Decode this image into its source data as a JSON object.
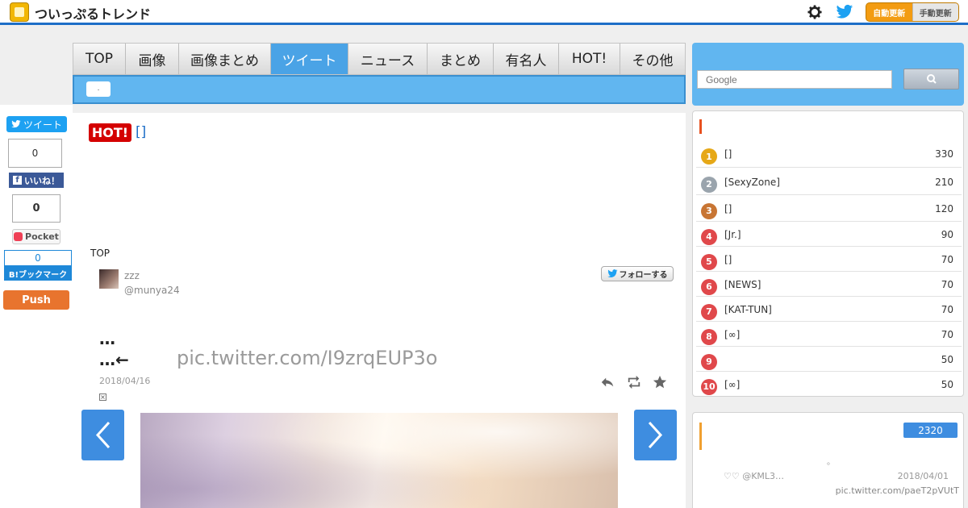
{
  "header": {
    "site_title": "ついっぷるトレンド",
    "auto_update_label": "自動更新",
    "manual_update_label": "手動更新"
  },
  "nav": {
    "tabs": [
      {
        "label": "TOP"
      },
      {
        "label": "画像"
      },
      {
        "label": "画像まとめ"
      },
      {
        "label": "ツイート"
      },
      {
        "label": "ニュース"
      },
      {
        "label": "まとめ"
      },
      {
        "label": "有名人"
      },
      {
        "label": "HOT!"
      },
      {
        "label": "その他"
      }
    ],
    "active_tab": "ツイート",
    "sub_label": "."
  },
  "share": {
    "tweet_label": "ツイート",
    "tweet_count": "0",
    "like_label": "いいね！",
    "like_count": "0",
    "pocket_label": "Pocket",
    "hatena_count": "0",
    "hatena_label": "B!ブックマーク",
    "push_label": "Push"
  },
  "article": {
    "hot_badge": "HOT!",
    "title": "[]",
    "breadcrumb": "TOP",
    "user_name": "zzz",
    "user_handle": "@munya24",
    "follow_label": "フォローする",
    "text_line1": "…",
    "text_line2": "…←",
    "pic_link": "pic.twitter.com/I9zrqEUP3o",
    "date": "2018/04/16",
    "close_mark": "×"
  },
  "search": {
    "placeholder": "Google"
  },
  "ranking": {
    "items": [
      {
        "rank": "1",
        "name": "[]",
        "count": "330",
        "color": "#e6a817"
      },
      {
        "rank": "2",
        "name": "[SexyZone]",
        "count": "210",
        "color": "#9aa4ad"
      },
      {
        "rank": "3",
        "name": "[]",
        "count": "120",
        "color": "#c87533"
      },
      {
        "rank": "4",
        "name": "[Jr.]",
        "count": "90",
        "color": "#e0484b"
      },
      {
        "rank": "5",
        "name": "[]",
        "count": "70",
        "color": "#e0484b"
      },
      {
        "rank": "6",
        "name": "[NEWS]",
        "count": "70",
        "color": "#e0484b"
      },
      {
        "rank": "7",
        "name": "[KAT-TUN]",
        "count": "70",
        "color": "#e0484b"
      },
      {
        "rank": "8",
        "name": "[∞]",
        "count": "70",
        "color": "#e0484b"
      },
      {
        "rank": "9",
        "name": "",
        "count": "50",
        "color": "#e0484b"
      },
      {
        "rank": "10",
        "name": "[∞]",
        "count": "50",
        "color": "#e0484b"
      }
    ]
  },
  "panel2": {
    "badge": "2320",
    "dot": "。",
    "user": "♡♡ @KML3…",
    "date": "2018/04/01",
    "link": "pic.twitter.com/paeT2pVUtT"
  },
  "colors": {
    "accent_blue": "#61b6f0",
    "header_line": "#1d6ec7",
    "hot_red": "#d40000",
    "update_orange": "#f39c12"
  }
}
